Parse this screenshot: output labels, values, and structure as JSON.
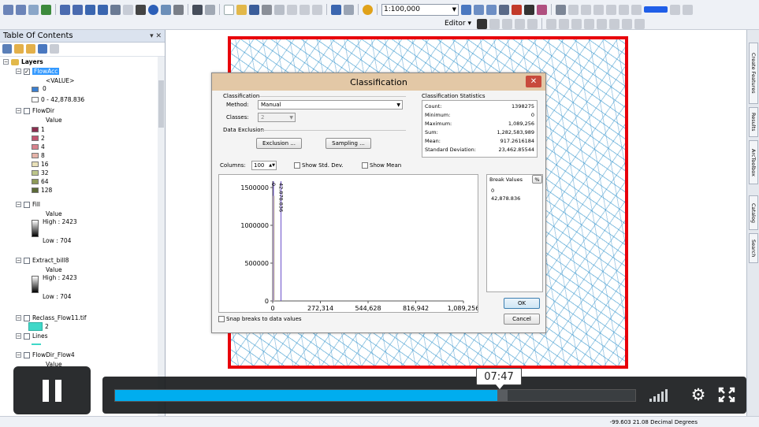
{
  "toolbar": {
    "scale_value": "1:100,000",
    "editor_label": "Editor ▾",
    "colors": {
      "accent": "#3a6fb5",
      "active_color_swatch": "#1f5ee8"
    }
  },
  "toc": {
    "title": "Table Of Contents",
    "controls": "▾ ✕",
    "layers_group": "Layers",
    "layers": [
      {
        "name": "FlowAcc",
        "field": "<VALUE>",
        "classes": [
          "0",
          "0 - 42,878.836"
        ]
      },
      {
        "name": "FlowDir",
        "field": "Value",
        "classes": [
          "1",
          "2",
          "4",
          "8",
          "16",
          "32",
          "64",
          "128"
        ]
      },
      {
        "name": "Fill",
        "field": "Value",
        "high": "High : 2423",
        "low": "Low : 704"
      },
      {
        "name": "Extract_bill8",
        "field": "Value",
        "high": "High : 2423",
        "low": "Low : 704"
      },
      {
        "name": "Reclass_Flow11.tif",
        "classes": [
          "2"
        ]
      },
      {
        "name": "Lines"
      },
      {
        "name": "FlowDir_Flow4",
        "field": "Value"
      }
    ],
    "flowdir_colors": [
      "#8b2e4f",
      "#c2546f",
      "#d9838d",
      "#e5b3a8",
      "#e8e0b8",
      "#bcc58a",
      "#8e9a58",
      "#5b6a37"
    ],
    "reclass_color": "#3fd8c8",
    "lines_color": "#3fd8c8"
  },
  "right_dock": {
    "tabs": [
      "Create Features",
      "Results",
      "ArcToolbox",
      "Catalog",
      "Search"
    ]
  },
  "status": {
    "coords": "-99.603  21.08 Decimal Degrees"
  },
  "dialog": {
    "title": "Classification",
    "close_icon": "✕",
    "classification": {
      "group_label": "Classification",
      "method_label": "Method:",
      "method_value": "Manual",
      "classes_label": "Classes:",
      "classes_value": "2"
    },
    "exclusion": {
      "group_label": "Data Exclusion",
      "exclusion_button": "Exclusion ...",
      "sampling_button": "Sampling ..."
    },
    "stats": {
      "group_label": "Classification Statistics",
      "rows": [
        {
          "k": "Count:",
          "v": "1398275"
        },
        {
          "k": "Minimum:",
          "v": "0"
        },
        {
          "k": "Maximum:",
          "v": "1,089,256"
        },
        {
          "k": "Sum:",
          "v": "1,282,583,989"
        },
        {
          "k": "Mean:",
          "v": "917.2616184"
        },
        {
          "k": "Standard Deviation:",
          "v": "23,462.85544"
        }
      ]
    },
    "columns_label": "Columns:",
    "columns_value": "100",
    "show_std_dev": "Show Std. Dev.",
    "show_mean": "Show Mean",
    "snap_breaks": "Snap breaks to data values",
    "break_values": {
      "header": "Break Values",
      "pct": "%",
      "values": [
        "0",
        "42,878.836"
      ]
    },
    "ok_button": "OK",
    "cancel_button": "Cancel"
  },
  "chart_data": {
    "type": "bar",
    "title": "",
    "xlabel": "",
    "ylabel": "",
    "x_ticks": [
      "0",
      "272,314",
      "544,628",
      "816,942",
      "1,089,256"
    ],
    "y_ticks": [
      "0",
      "500000",
      "1000000",
      "1500000"
    ],
    "xlim": [
      0,
      1089256
    ],
    "ylim": [
      0,
      1500000
    ],
    "histogram": [
      {
        "x": 0,
        "count": 1390000
      }
    ],
    "break_lines": [
      {
        "value": 0,
        "label": "0"
      },
      {
        "value": 42878.836,
        "label": "42,878.836"
      }
    ],
    "break_line_color": "#6b4fc9",
    "bar_color": "#e8e2a8"
  },
  "video": {
    "time_label": "07:47",
    "progress": 0.735,
    "buffered": 0.755,
    "pause_icon": "pause-icon",
    "settings_icon": "gear-icon",
    "fullscreen_icon": "fullscreen-icon"
  }
}
